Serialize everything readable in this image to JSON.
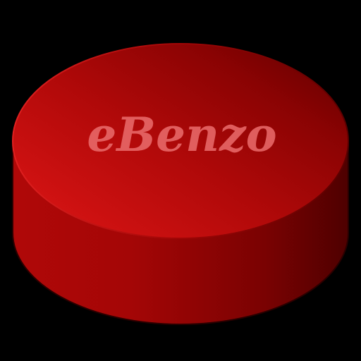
{
  "app_icon": {
    "logo_text": "eBenzo",
    "colors": {
      "background": "#000000",
      "top_light": "#cc1010",
      "top_dark": "#6e0000",
      "side_light": "#c00a0a",
      "side_dark": "#500000",
      "edge": "#300000",
      "logo_text": "#e86a6a"
    }
  }
}
